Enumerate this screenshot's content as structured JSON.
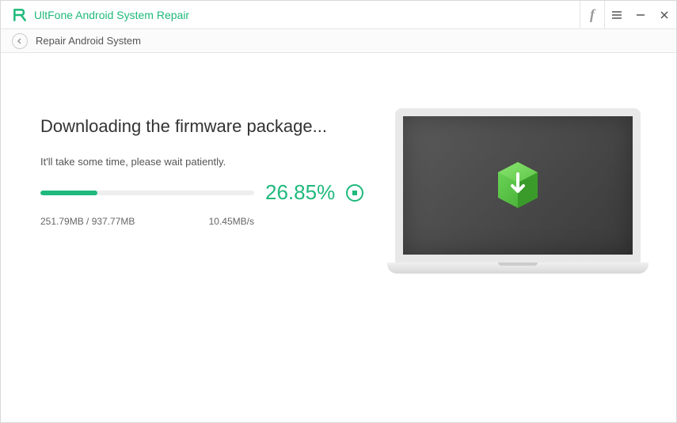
{
  "app": {
    "title": "UltFone Android System Repair"
  },
  "breadcrumb": {
    "label": "Repair Android System"
  },
  "download": {
    "heading": "Downloading the firmware package...",
    "subtext": "It'll take some time, please wait patiently.",
    "percent_label": "26.85%",
    "percent_value": 26.85,
    "downloaded": "251.79MB",
    "total": "937.77MB",
    "size_label": "251.79MB / 937.77MB",
    "speed": "10.45MB/s"
  },
  "colors": {
    "accent": "#1fb97b"
  }
}
